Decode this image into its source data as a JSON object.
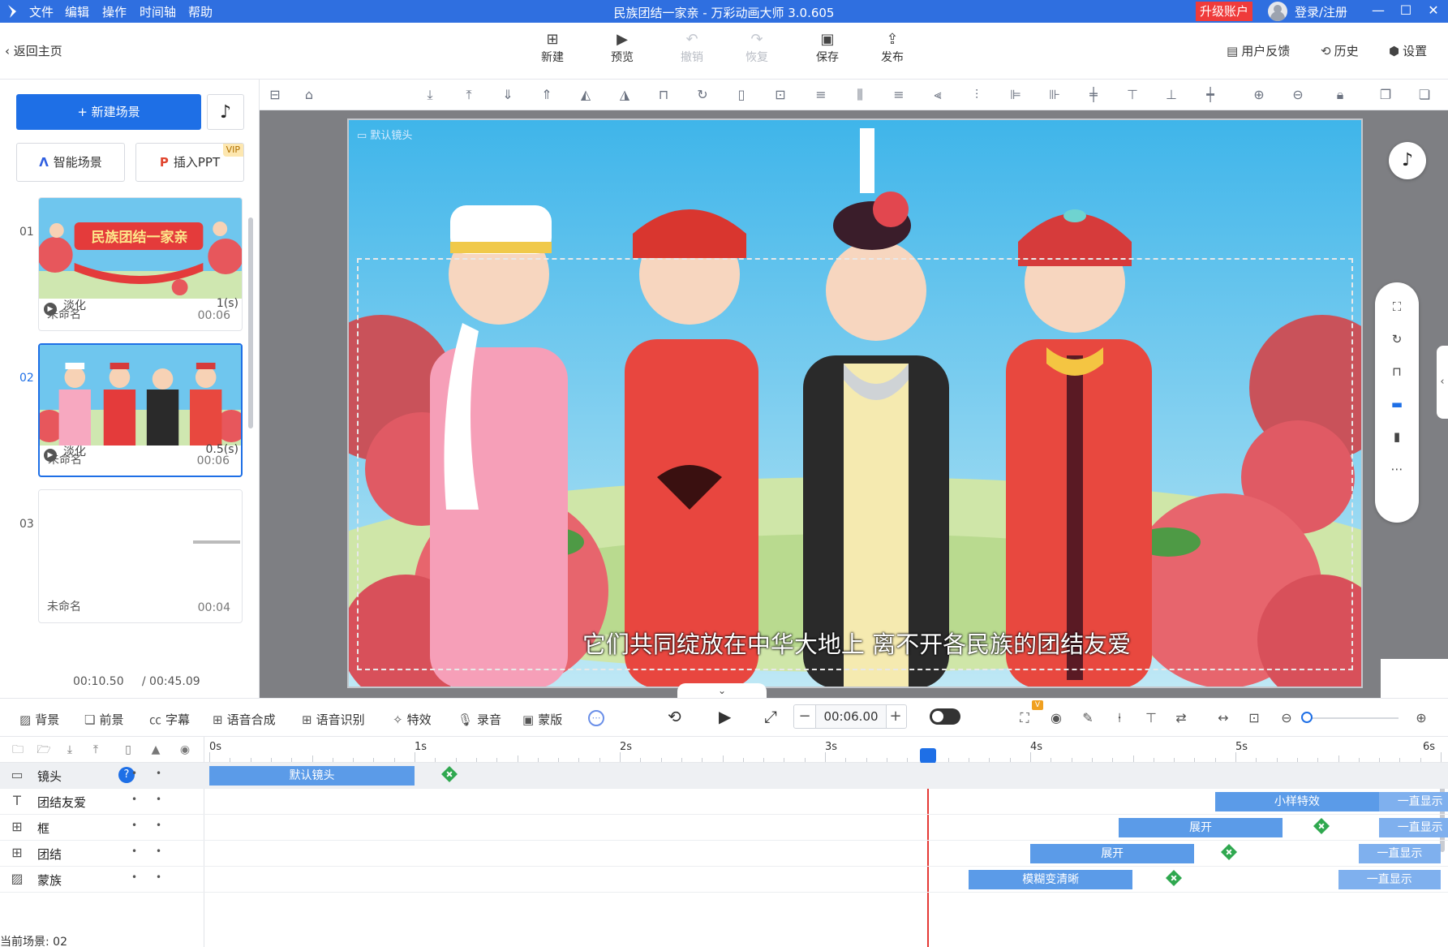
{
  "app": {
    "title": "民族团结一家亲 - 万彩动画大师 3.0.605",
    "menu": [
      "文件",
      "编辑",
      "操作",
      "时间轴",
      "帮助"
    ],
    "upgrade_label": "升级账户",
    "login_label": "登录/注册"
  },
  "topbar": {
    "back_label": "返回主页",
    "buttons": [
      {
        "label": "新建",
        "icon": "new-file-icon",
        "enabled": true
      },
      {
        "label": "预览",
        "icon": "play-icon",
        "enabled": true
      },
      {
        "label": "撤销",
        "icon": "undo-icon",
        "enabled": false
      },
      {
        "label": "恢复",
        "icon": "redo-icon",
        "enabled": false
      },
      {
        "label": "保存",
        "icon": "save-icon",
        "enabled": true
      },
      {
        "label": "发布",
        "icon": "publish-icon",
        "enabled": true
      }
    ],
    "right": [
      {
        "label": "用户反馈",
        "icon": "feedback-icon"
      },
      {
        "label": "历史",
        "icon": "history-icon"
      },
      {
        "label": "设置",
        "icon": "gear-icon"
      }
    ]
  },
  "left": {
    "new_scene_label": "+ 新建场景",
    "smart_scene_label": "智能场景",
    "insert_ppt_label": "插入PPT",
    "vip_badge": "VIP",
    "scenes": [
      {
        "num": "01",
        "name": "未命名",
        "duration": "00:06",
        "transition": "淡化",
        "transition_time": "1(s)"
      },
      {
        "num": "02",
        "name": "未命名",
        "duration": "00:06",
        "transition": "淡化",
        "transition_time": "0.5(s)"
      },
      {
        "num": "03",
        "name": "未命名",
        "duration": "00:04"
      }
    ],
    "scene1_banner": "民族团结一家亲",
    "current_time": "00:10.50",
    "total_time": "/ 00:45.09"
  },
  "canvas": {
    "camera_label": "默认镜头",
    "subtitle": "它们共同绽放在中华大地上 离不开各民族的团结友爱"
  },
  "timeline_toolbar": {
    "tools": [
      {
        "label": "背景",
        "icon": "background-icon"
      },
      {
        "label": "前景",
        "icon": "foreground-icon"
      },
      {
        "label": "字幕",
        "icon": "caption-icon"
      },
      {
        "label": "语音合成",
        "icon": "tts-icon"
      },
      {
        "label": "语音识别",
        "icon": "speech-recognition-icon"
      },
      {
        "label": "特效",
        "icon": "effects-icon"
      },
      {
        "label": "录音",
        "icon": "microphone-icon"
      },
      {
        "label": "蒙版",
        "icon": "mask-icon"
      }
    ],
    "time_value": "00:06.00",
    "vip_dot": "V"
  },
  "timeline": {
    "ruler": [
      "0s",
      "1s",
      "2s",
      "3s",
      "4s",
      "5s",
      "6s"
    ],
    "playhead_seconds": 3.5,
    "tracks": [
      {
        "name": "镜头",
        "icon": "camera-icon",
        "help": "?",
        "clips": [
          {
            "label": "默认镜头",
            "start": 0.0,
            "end": 1.0
          }
        ],
        "keyframes": [
          1.17
        ]
      },
      {
        "name": "团结友爱",
        "icon": "text-icon",
        "clips": [
          {
            "label": "小样特效",
            "start": 4.9,
            "end": 5.7
          },
          {
            "label": "一直显示",
            "start": 5.7,
            "end": 6.1
          }
        ],
        "keyframes": []
      },
      {
        "name": "框",
        "icon": "image-group-icon",
        "clips": [
          {
            "label": "展开",
            "start": 4.43,
            "end": 5.23
          },
          {
            "label": "一直显示",
            "start": 5.7,
            "end": 6.1
          }
        ],
        "keyframes": [
          5.42
        ]
      },
      {
        "name": "团结",
        "icon": "image-group-icon",
        "clips": [
          {
            "label": "展开",
            "start": 4.0,
            "end": 4.8
          },
          {
            "label": "一直显示",
            "start": 5.6,
            "end": 6.0
          }
        ],
        "keyframes": [
          4.97
        ]
      },
      {
        "name": "蒙族",
        "icon": "image-icon",
        "clips": [
          {
            "label": "模糊变清晰",
            "start": 3.7,
            "end": 4.5
          },
          {
            "label": "一直显示",
            "start": 5.5,
            "end": 6.0
          }
        ],
        "keyframes": [
          4.7
        ]
      }
    ],
    "status": "当前场景: 02"
  },
  "colors": {
    "accent": "#1e6fe6",
    "titlebar": "#2f6fe0",
    "clip": "#5b9be8",
    "keyframe": "#2fa84f",
    "playhead": "#e53935",
    "upgrade": "#ef3b3b"
  }
}
